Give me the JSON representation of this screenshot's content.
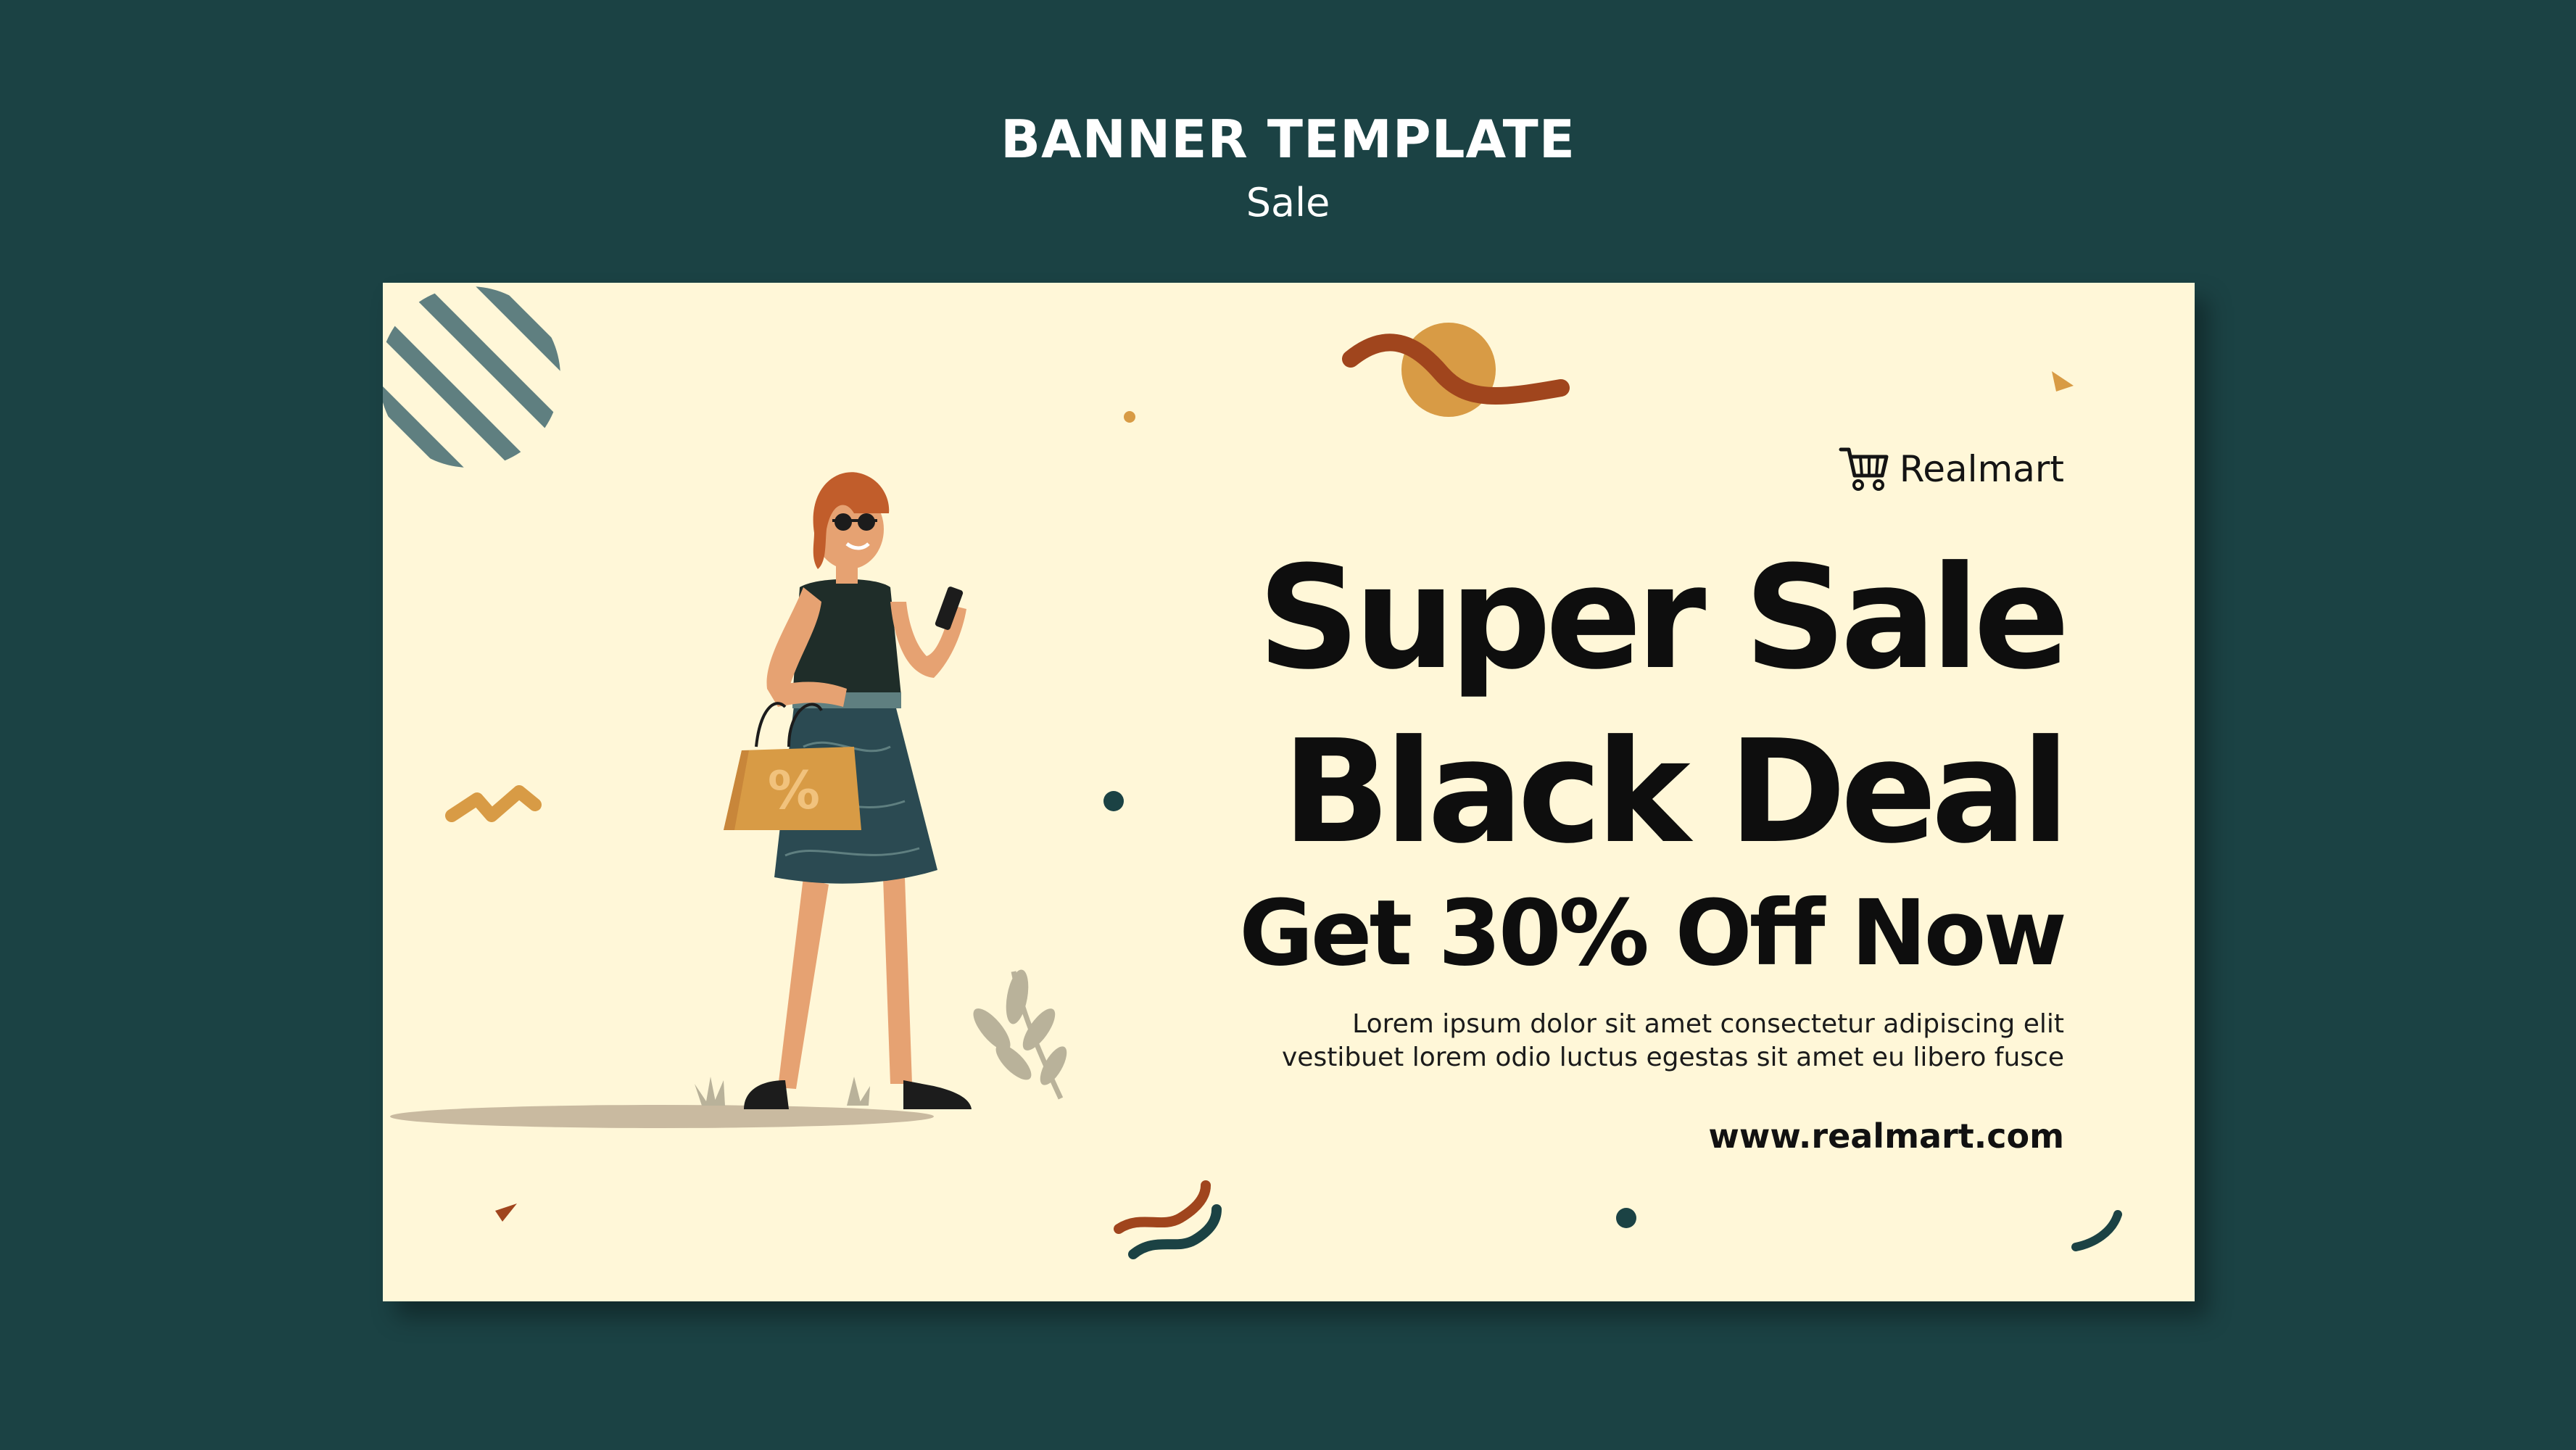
{
  "header": {
    "title": "BANNER TEMPLATE",
    "subtitle": "Sale"
  },
  "banner": {
    "brand": {
      "icon": "shopping-cart-icon",
      "name": "Realmart"
    },
    "headline_line1": "Super Sale",
    "headline_line2": "Black Deal",
    "offer": "Get 30% Off Now",
    "body_line1": "Lorem ipsum dolor sit amet consectetur adipiscing elit",
    "body_line2": "vestibuet lorem odio luctus egestas sit amet eu libero fusce",
    "url": "www.realmart.com",
    "illustration": {
      "bag_label": "%"
    }
  },
  "colors": {
    "page_background": "#1b4244",
    "banner_background": "#fff7d8",
    "text_dark": "#0e0e0e",
    "accent_mustard": "#d89b45",
    "accent_rust": "#a0451d",
    "accent_slate": "#5f7f80"
  }
}
